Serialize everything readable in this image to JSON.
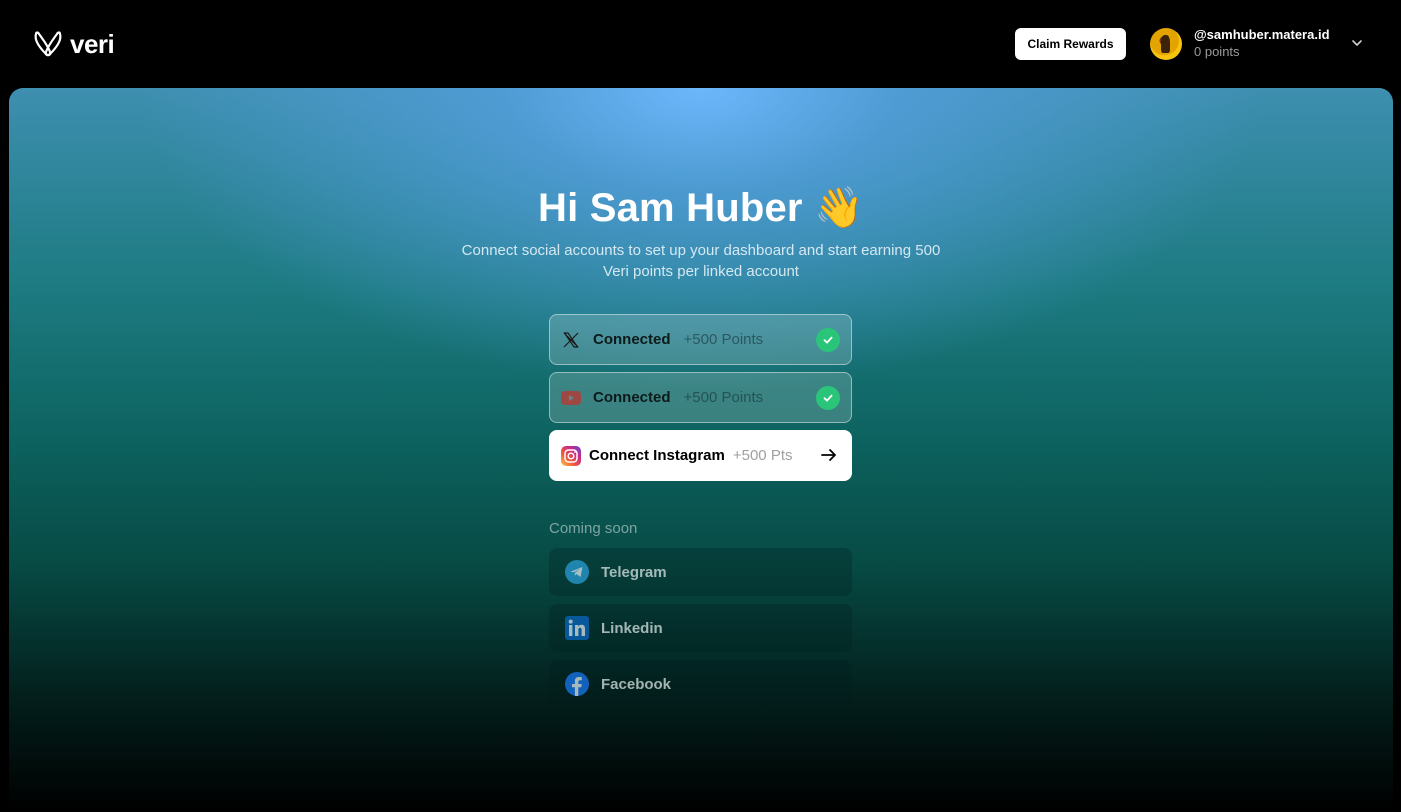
{
  "header": {
    "logo_text": "veri",
    "claim_label": "Claim Rewards",
    "user": {
      "handle": "@samhuber.matera.id",
      "points": "0 points"
    }
  },
  "hero": {
    "title": "Hi Sam Huber 👋",
    "subtitle": "Connect social accounts to set up your dashboard and start earning 500 Veri points per linked account"
  },
  "accounts": [
    {
      "platform_icon": "x-icon",
      "status": "Connected",
      "points": "+500 Points"
    },
    {
      "platform_icon": "youtube-icon",
      "status": "Connected",
      "points": "+500 Points"
    },
    {
      "platform_icon": "instagram-icon",
      "label": "Connect Instagram",
      "points": "+500 Pts"
    }
  ],
  "coming_soon": {
    "heading": "Coming soon",
    "items": [
      {
        "icon": "telegram-icon",
        "label": "Telegram"
      },
      {
        "icon": "linkedin-icon",
        "label": "Linkedin"
      },
      {
        "icon": "facebook-icon",
        "label": "Facebook"
      }
    ]
  },
  "colors": {
    "check_green": "#2bc57a",
    "youtube_red": "#c4302b",
    "telegram_blue": "#2a9ed6",
    "linkedin_blue": "#0a66c2",
    "facebook_blue": "#1877f2"
  }
}
